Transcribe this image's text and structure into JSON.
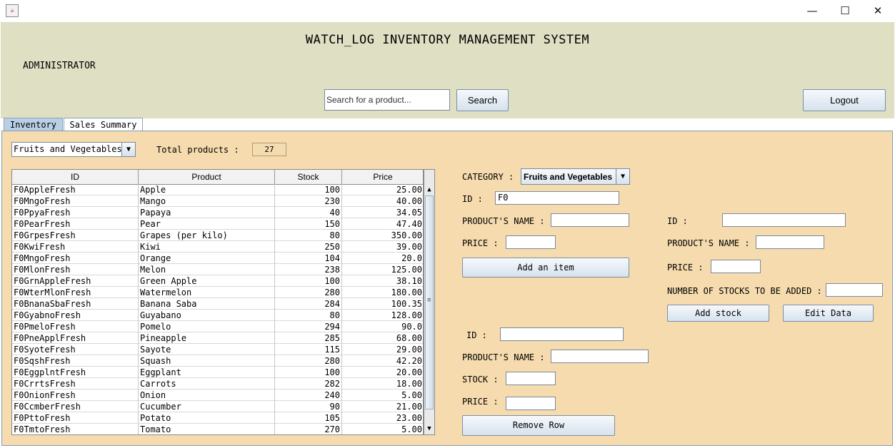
{
  "window": {
    "icon": "java-icon",
    "controls": {
      "minimize": "—",
      "maximize": "☐",
      "close": "✕"
    }
  },
  "header": {
    "title": "WATCH_LOG INVENTORY MANAGEMENT SYSTEM",
    "role": "ADMINISTRATOR",
    "search_placeholder": "Search for a product...",
    "search_button": "Search",
    "logout_button": "Logout"
  },
  "tabs": [
    {
      "label": "Inventory",
      "selected": true
    },
    {
      "label": "Sales Summary",
      "selected": false
    }
  ],
  "inventory": {
    "category_filter": "Fruits and Vegetables",
    "total_label": "Total products :",
    "total_value": "27",
    "columns": [
      "ID",
      "Product",
      "Stock",
      "Price"
    ],
    "rows": [
      [
        "F0AppleFresh",
        "Apple",
        "100",
        "25.00"
      ],
      [
        "F0MngoFresh",
        "Mango",
        "230",
        "40.00"
      ],
      [
        "F0PpyaFresh",
        "Papaya",
        "40",
        "34.05"
      ],
      [
        "F0PearFresh",
        "Pear",
        "150",
        "47.40"
      ],
      [
        "F0GrpesFresh",
        "Grapes (per kilo)",
        "80",
        "350.00"
      ],
      [
        "F0KwiFresh",
        "Kiwi",
        "250",
        "39.00"
      ],
      [
        "F0MngoFresh",
        "Orange",
        "104",
        "20.0"
      ],
      [
        "F0MlonFresh",
        "Melon",
        "238",
        "125.00"
      ],
      [
        "F0GrnAppleFresh",
        "Green Apple",
        "100",
        "38.10"
      ],
      [
        "F0WterMlonFresh",
        "Watermelon",
        "280",
        "180.00"
      ],
      [
        "F0BnanaSbaFresh",
        "Banana Saba",
        "284",
        "100.35"
      ],
      [
        "F0GyabnoFresh",
        "Guyabano",
        "80",
        "128.00"
      ],
      [
        "F0PmeloFresh",
        "Pomelo",
        "294",
        "90.0"
      ],
      [
        "F0PneApplFresh",
        "Pineapple",
        "285",
        "68.00"
      ],
      [
        "F0SyoteFresh",
        "Sayote",
        "115",
        "29.00"
      ],
      [
        "F0SqshFresh",
        "Squash",
        "280",
        "42.20"
      ],
      [
        "F0EggplntFresh",
        "Eggplant",
        "100",
        "20.00"
      ],
      [
        "F0CrrtsFresh",
        "Carrots",
        "282",
        "18.00"
      ],
      [
        "F0OnionFresh",
        "Onion",
        "240",
        "5.00"
      ],
      [
        "F0CcmberFresh",
        "Cucumber",
        "90",
        "21.00"
      ],
      [
        "F0PttoFresh",
        "Potato",
        "105",
        "23.00"
      ],
      [
        "F0TmtoFresh",
        "Tomato",
        "270",
        "5.00"
      ]
    ]
  },
  "add_item_form": {
    "category_label": "CATEGORY :",
    "category_value": "Fruits and Vegetables",
    "id_label": "ID :",
    "id_value": "F0",
    "name_label": "PRODUCT'S NAME :",
    "price_label": "PRICE :",
    "button": "Add an item"
  },
  "add_stock_form": {
    "id_label": "ID :",
    "name_label": "PRODUCT'S NAME :",
    "price_label": "PRICE :",
    "stocks_label": "NUMBER OF STOCKS TO BE ADDED :",
    "add_stock_button": "Add stock",
    "edit_button": "Edit Data"
  },
  "remove_form": {
    "id_label": "ID :",
    "name_label": "PRODUCT'S NAME :",
    "stock_label": "STOCK :",
    "price_label": "PRICE :",
    "button": "Remove Row"
  }
}
